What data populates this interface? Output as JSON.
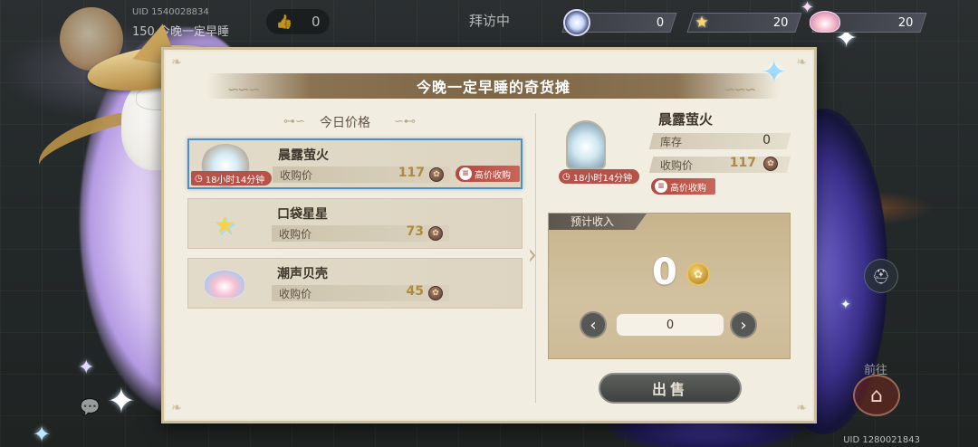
{
  "header": {
    "uid": "UID 1540028834",
    "player_name": "150 今晚一定早睡",
    "likes": "0",
    "status": "拜访中"
  },
  "currencies": [
    {
      "icon": "planet-orb-icon",
      "value": "0"
    },
    {
      "icon": "star-icon",
      "value": "20"
    },
    {
      "icon": "shell-icon",
      "value": "20"
    }
  ],
  "shop": {
    "title": "今晚一定早睡的奇货摊",
    "today_header": "今日价格",
    "price_label": "收购价",
    "high_price_tag": "高价收购",
    "items": [
      {
        "name": "晨露萤火",
        "price": "117",
        "timer": "18小时14分钟",
        "high_price": true,
        "selected": true,
        "icon": "glass-dome-icon"
      },
      {
        "name": "口袋星星",
        "price": "73",
        "timer": "",
        "high_price": false,
        "selected": false,
        "icon": "pocket-star-icon"
      },
      {
        "name": "潮声贝壳",
        "price": "45",
        "timer": "",
        "high_price": false,
        "selected": false,
        "icon": "tide-shell-icon"
      }
    ]
  },
  "detail": {
    "name": "晨露萤火",
    "timer": "18小时14分钟",
    "stock_label": "库存",
    "stock_value": "0",
    "price_label": "收购价",
    "price_value": "117",
    "high_price_tag": "高价收购",
    "income_label": "预计收入",
    "income_value": "0",
    "quantity": "0",
    "sell_label": "出售"
  },
  "footer": {
    "goto_label": "前往",
    "uid": "UID 1280021843"
  },
  "colors": {
    "panel_bg": "#f1ede0",
    "title_bar": "#7d6646",
    "price_gold": "#b08a3c",
    "tag_red": "#b5534a",
    "selection_blue": "#4f8fbf",
    "income_box": "#cdbb96",
    "sell_button": "#4a4c4a"
  }
}
